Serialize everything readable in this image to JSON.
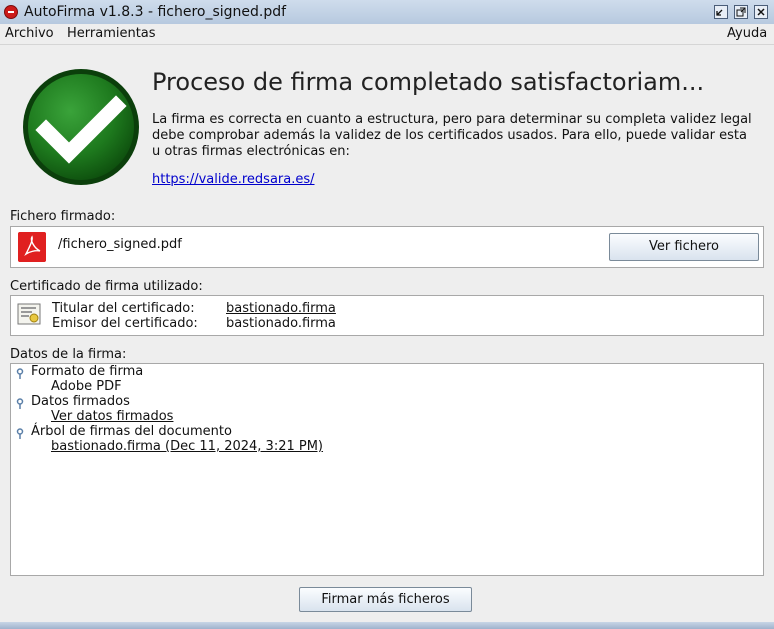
{
  "window": {
    "title": "AutoFirma v1.8.3 - fichero_signed.pdf"
  },
  "menu": {
    "archivo": "Archivo",
    "herramientas": "Herramientas",
    "ayuda": "Ayuda"
  },
  "result": {
    "heading": "Proceso de firma completado satisfactoriam...",
    "description": "La firma es correcta en cuanto a estructura, pero para determinar su completa validez legal debe comprobar además la validez de los certificados usados. Para ello, puede validar esta u otras firmas electrónicas en:",
    "validation_link": "https://valide.redsara.es/"
  },
  "signed_file": {
    "section_label": "Fichero firmado:",
    "file_name": "/fichero_signed.pdf",
    "view_button": "Ver fichero"
  },
  "certificate": {
    "section_label": "Certificado de firma utilizado:",
    "holder_label": "Titular del certificado:",
    "holder_value": "bastionado.firma",
    "issuer_label": "Emisor del certificado:",
    "issuer_value": "bastionado.firma"
  },
  "signature_data": {
    "section_label": "Datos de la firma:",
    "format_label": "Formato de firma",
    "format_value": "Adobe PDF",
    "signed_data_label": "Datos firmados",
    "signed_data_link": "Ver datos firmados",
    "tree_label": "Árbol de firmas del documento",
    "tree_value": "bastionado.firma (Dec 11, 2024, 3:21 PM)"
  },
  "actions": {
    "sign_more": "Firmar más ficheros"
  },
  "icons": {
    "app": "autofirma-logo-icon",
    "success": "check-circle-icon",
    "pdf": "pdf-file-icon",
    "certificate": "certificate-icon",
    "tree_node": "tree-node-icon"
  },
  "colors": {
    "success_green": "#1e7a1e",
    "link": "#0000cc",
    "pdf_red": "#e02020"
  }
}
